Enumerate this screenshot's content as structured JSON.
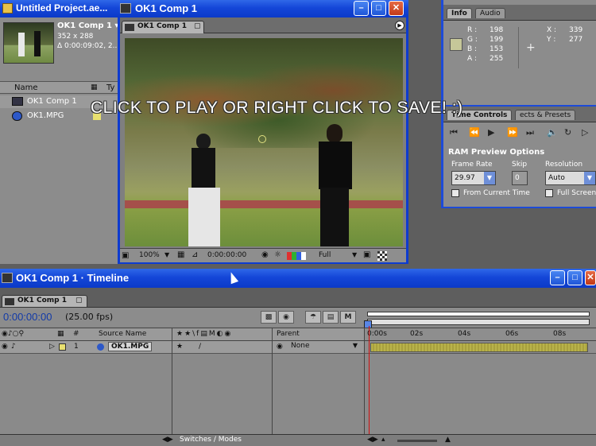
{
  "project": {
    "title": "Untitled Project.ae...",
    "comp_name": "OK1 Comp 1 ▾",
    "dimensions": "352 x 288",
    "duration": "Δ 0:00:09:02, 2...",
    "columns": {
      "name": "Name",
      "type": "Ty"
    },
    "items": [
      {
        "label": "OK1 Comp 1",
        "icon": "composition-icon"
      },
      {
        "label": "OK1.MPG",
        "icon": "footage-icon"
      }
    ]
  },
  "comp_window": {
    "title": "OK1 Comp 1",
    "tab": "OK1 Comp 1",
    "overlay": "CLICK TO PLAY OR RIGHT CLICK TO SAVE! :)",
    "zoom": "100%",
    "timecode": "0:00:00:00",
    "resolution": "Full"
  },
  "info": {
    "tabs": [
      "Info",
      "Audio"
    ],
    "r_label": "R :",
    "r": "198",
    "g_label": "G :",
    "g": "199",
    "b_label": "B :",
    "b": "153",
    "a_label": "A :",
    "a": "255",
    "x_label": "X :",
    "x": "339",
    "y_label": "Y :",
    "y": "277",
    "swatch": "#c6c799"
  },
  "time_controls": {
    "tabs": [
      "Time Controls",
      "ects & Presets"
    ],
    "ram_title": "RAM Preview Options",
    "frame_rate_label": "Frame Rate",
    "frame_rate": "29.97",
    "skip_label": "Skip",
    "skip": "0",
    "resolution_label": "Resolution",
    "resolution": "Auto",
    "from_current": "From Current Time",
    "full_screen": "Full Screen"
  },
  "timeline": {
    "title": "OK1 Comp 1 · Timeline",
    "tab": "OK1 Comp 1",
    "timecode": "0:00:00:00",
    "fps": "(25.00 fps)",
    "source_name_header": "Source Name",
    "parent_header": "Parent",
    "layer_number": "1",
    "layer_name": "OK1.MPG",
    "parent_value": "None",
    "ruler": [
      "0:00s",
      "02s",
      "04s",
      "06s",
      "08s"
    ],
    "footer": "Switches / Modes",
    "track_color": "#b8b24a",
    "playhead_color": "#d01010"
  }
}
